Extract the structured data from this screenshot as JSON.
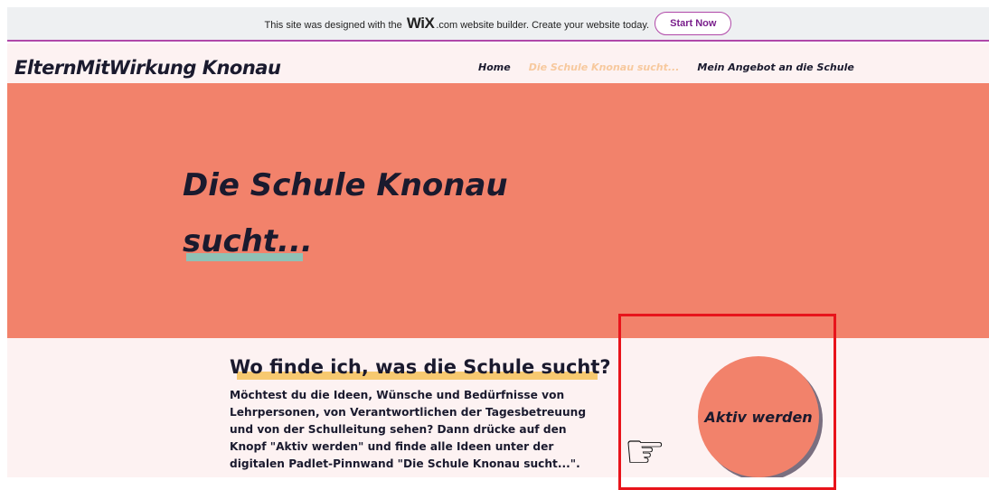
{
  "wix_banner": {
    "text_before": "This site was designed with the",
    "logo": "WiX",
    "text_after": ".com website builder. Create your website today.",
    "button_label": "Start Now"
  },
  "header": {
    "site_title": "ElternMitWirkung Knonau",
    "nav": [
      {
        "label": "Home",
        "active": false
      },
      {
        "label": "Die Schule Knonau sucht...",
        "active": true
      },
      {
        "label": "Mein Angebot an die Schule",
        "active": false
      }
    ]
  },
  "hero": {
    "title": "Die Schule Knonau sucht..."
  },
  "content": {
    "title": "Wo finde ich, was die Schule sucht?",
    "body": "Möchtest du die Ideen, Wünsche und Bedürfnisse von Lehrpersonen, von Verantwortlichen der Tagesbetreuung und von der Schulleitung sehen? Dann drücke auf den Knopf \"Aktiv werden\" und finde alle Ideen unter der digitalen Padlet-Pinnwand \"Die Schule Knonau sucht...\".",
    "cta_label": "Aktiv werden",
    "pointer_icon": "pointing-hand-icon"
  },
  "colors": {
    "hero_bg": "#f2826b",
    "page_bg": "#fdf2f2",
    "nav_active": "#f7c99e",
    "teal_accent": "#8fc1b5",
    "yellow_accent": "#f7c970",
    "highlight_box": "#e8141b"
  }
}
